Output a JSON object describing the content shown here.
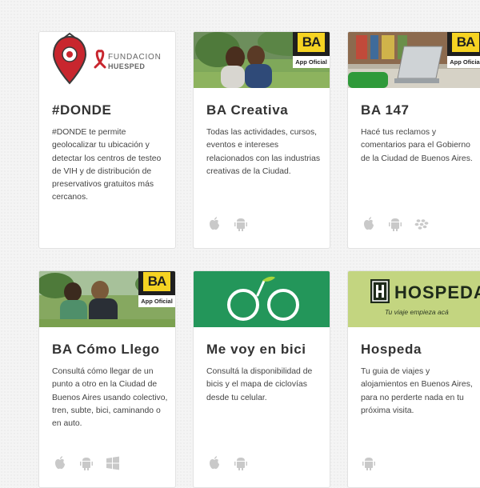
{
  "colors": {
    "accent_yellow": "#f6d322",
    "badge_dark": "#1f1f1f",
    "bici_green": "#23965a",
    "hospeda_green": "#c3d580",
    "donde_red": "#c8262e"
  },
  "badge": {
    "logo_text": "BA",
    "official_label": "App Oficial"
  },
  "cards": [
    {
      "title": "#DONDE",
      "description": "#DONDE te permite geolocalizar tu ubicación y detectar los centros de testeo de VIH y de distribución de preservativos gratuitos más cercanos.",
      "logo_line1": "FUNDACION",
      "logo_line2": "HUESPED",
      "platforms": []
    },
    {
      "title": "BA Creativa",
      "description": "Todas las actividades, cursos, eventos e intereses relacionados con las industrias creativas de la Ciudad.",
      "platforms": [
        "apple-icon",
        "android-icon"
      ]
    },
    {
      "title": "BA 147",
      "description": "Hacé tus reclamos y comentarios para el Gobierno de la Ciudad de Buenos Aires.",
      "platforms": [
        "apple-icon",
        "android-icon",
        "blackberry-icon"
      ]
    },
    {
      "title": "BA Cómo Llego",
      "description": "Consultá cómo llegar de un punto a otro en la Ciudad de Buenos Aires usando colectivo, tren, subte, bici, caminando o en auto.",
      "platforms": [
        "apple-icon",
        "android-icon",
        "windows-icon"
      ]
    },
    {
      "title": "Me voy en bici",
      "description": "Consultá la disponibilidad de bicis y el mapa de ciclovías desde tu celular.",
      "platforms": [
        "apple-icon",
        "android-icon"
      ]
    },
    {
      "title": "Hospeda",
      "description": "Tu guia de viajes y alojamientos en Buenos Aires, para no perderte nada en tu próxima visita.",
      "logo_name": "HOSPEDA",
      "logo_tagline": "Tu viaje empieza acá",
      "platforms": [
        "android-icon"
      ]
    }
  ]
}
